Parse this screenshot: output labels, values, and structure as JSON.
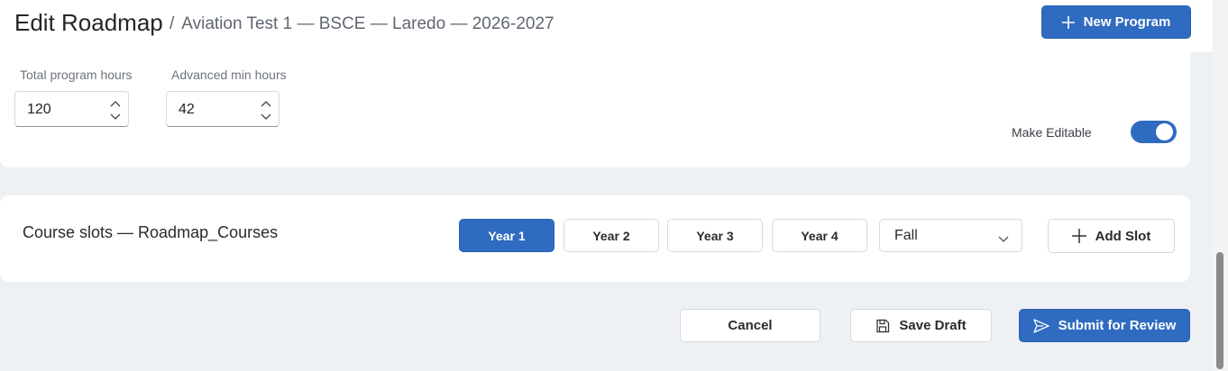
{
  "header": {
    "title": "Edit Roadmap",
    "breadcrumb_sep": "/",
    "breadcrumb": "Aviation Test 1 — BSCE — Laredo — 2026-2027",
    "new_program_label": "New Program"
  },
  "settings": {
    "total_hours_label": "Total program hours",
    "total_hours_value": "120",
    "advanced_hours_label": "Advanced min hours",
    "advanced_hours_value": "42",
    "editable_label": "Make Editable",
    "editable_on": true
  },
  "slots": {
    "title": "Course slots — Roadmap_Courses",
    "tabs": [
      {
        "label": "Year 1",
        "active": true
      },
      {
        "label": "Year 2",
        "active": false
      },
      {
        "label": "Year 3",
        "active": false
      },
      {
        "label": "Year 4",
        "active": false
      }
    ],
    "term_selected": "Fall",
    "add_slot_label": "Add Slot"
  },
  "footer": {
    "cancel_label": "Cancel",
    "save_draft_label": "Save Draft",
    "submit_label": "Submit for Review"
  },
  "colors": {
    "accent": "#2f6bc0",
    "page_bg": "#eef1f4",
    "card_bg": "#ffffff"
  },
  "icons": {
    "new_program": "plus-icon",
    "add_slot": "plus-icon",
    "save_draft": "floppy-disk-icon",
    "submit": "send-icon",
    "term_select": "chevron-down-icon",
    "spinner_up": "chevron-up-icon",
    "spinner_down": "chevron-down-icon"
  }
}
